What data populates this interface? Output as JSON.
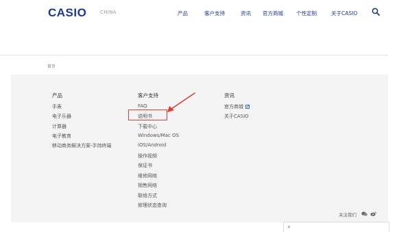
{
  "header": {
    "logo": "CASIO",
    "region": "CHINA",
    "nav": [
      "产品",
      "客户支持",
      "资讯",
      "官方商城",
      "个性定制",
      "关于CASIO"
    ]
  },
  "breadcrumb": "首页",
  "footer": {
    "col1": {
      "heading": "产品",
      "links": [
        "手表",
        "电子乐器",
        "计算器",
        "电子教育",
        "移动商务解决方案-手持终端"
      ]
    },
    "col2": {
      "heading": "客户支持",
      "links": [
        "FAQ",
        "说明书",
        "下载中心",
        "Windows/Mac OS",
        "iOS/Android",
        "操作视频",
        "保证书",
        "维修网络",
        "销售网络",
        "联络方式",
        "修理状态查询"
      ]
    },
    "col3": {
      "heading": "资讯",
      "links": [
        "官方商城",
        "关于CASIO"
      ]
    },
    "follow": "关注我们"
  },
  "colors": {
    "brand": "#1a3a8f",
    "highlight": "#e53a2f",
    "footer_bg": "#f4f4f4"
  },
  "icons": [
    "search-icon",
    "external-link-icon",
    "wechat-icon",
    "weibo-icon",
    "annotation-arrow-icon"
  ]
}
